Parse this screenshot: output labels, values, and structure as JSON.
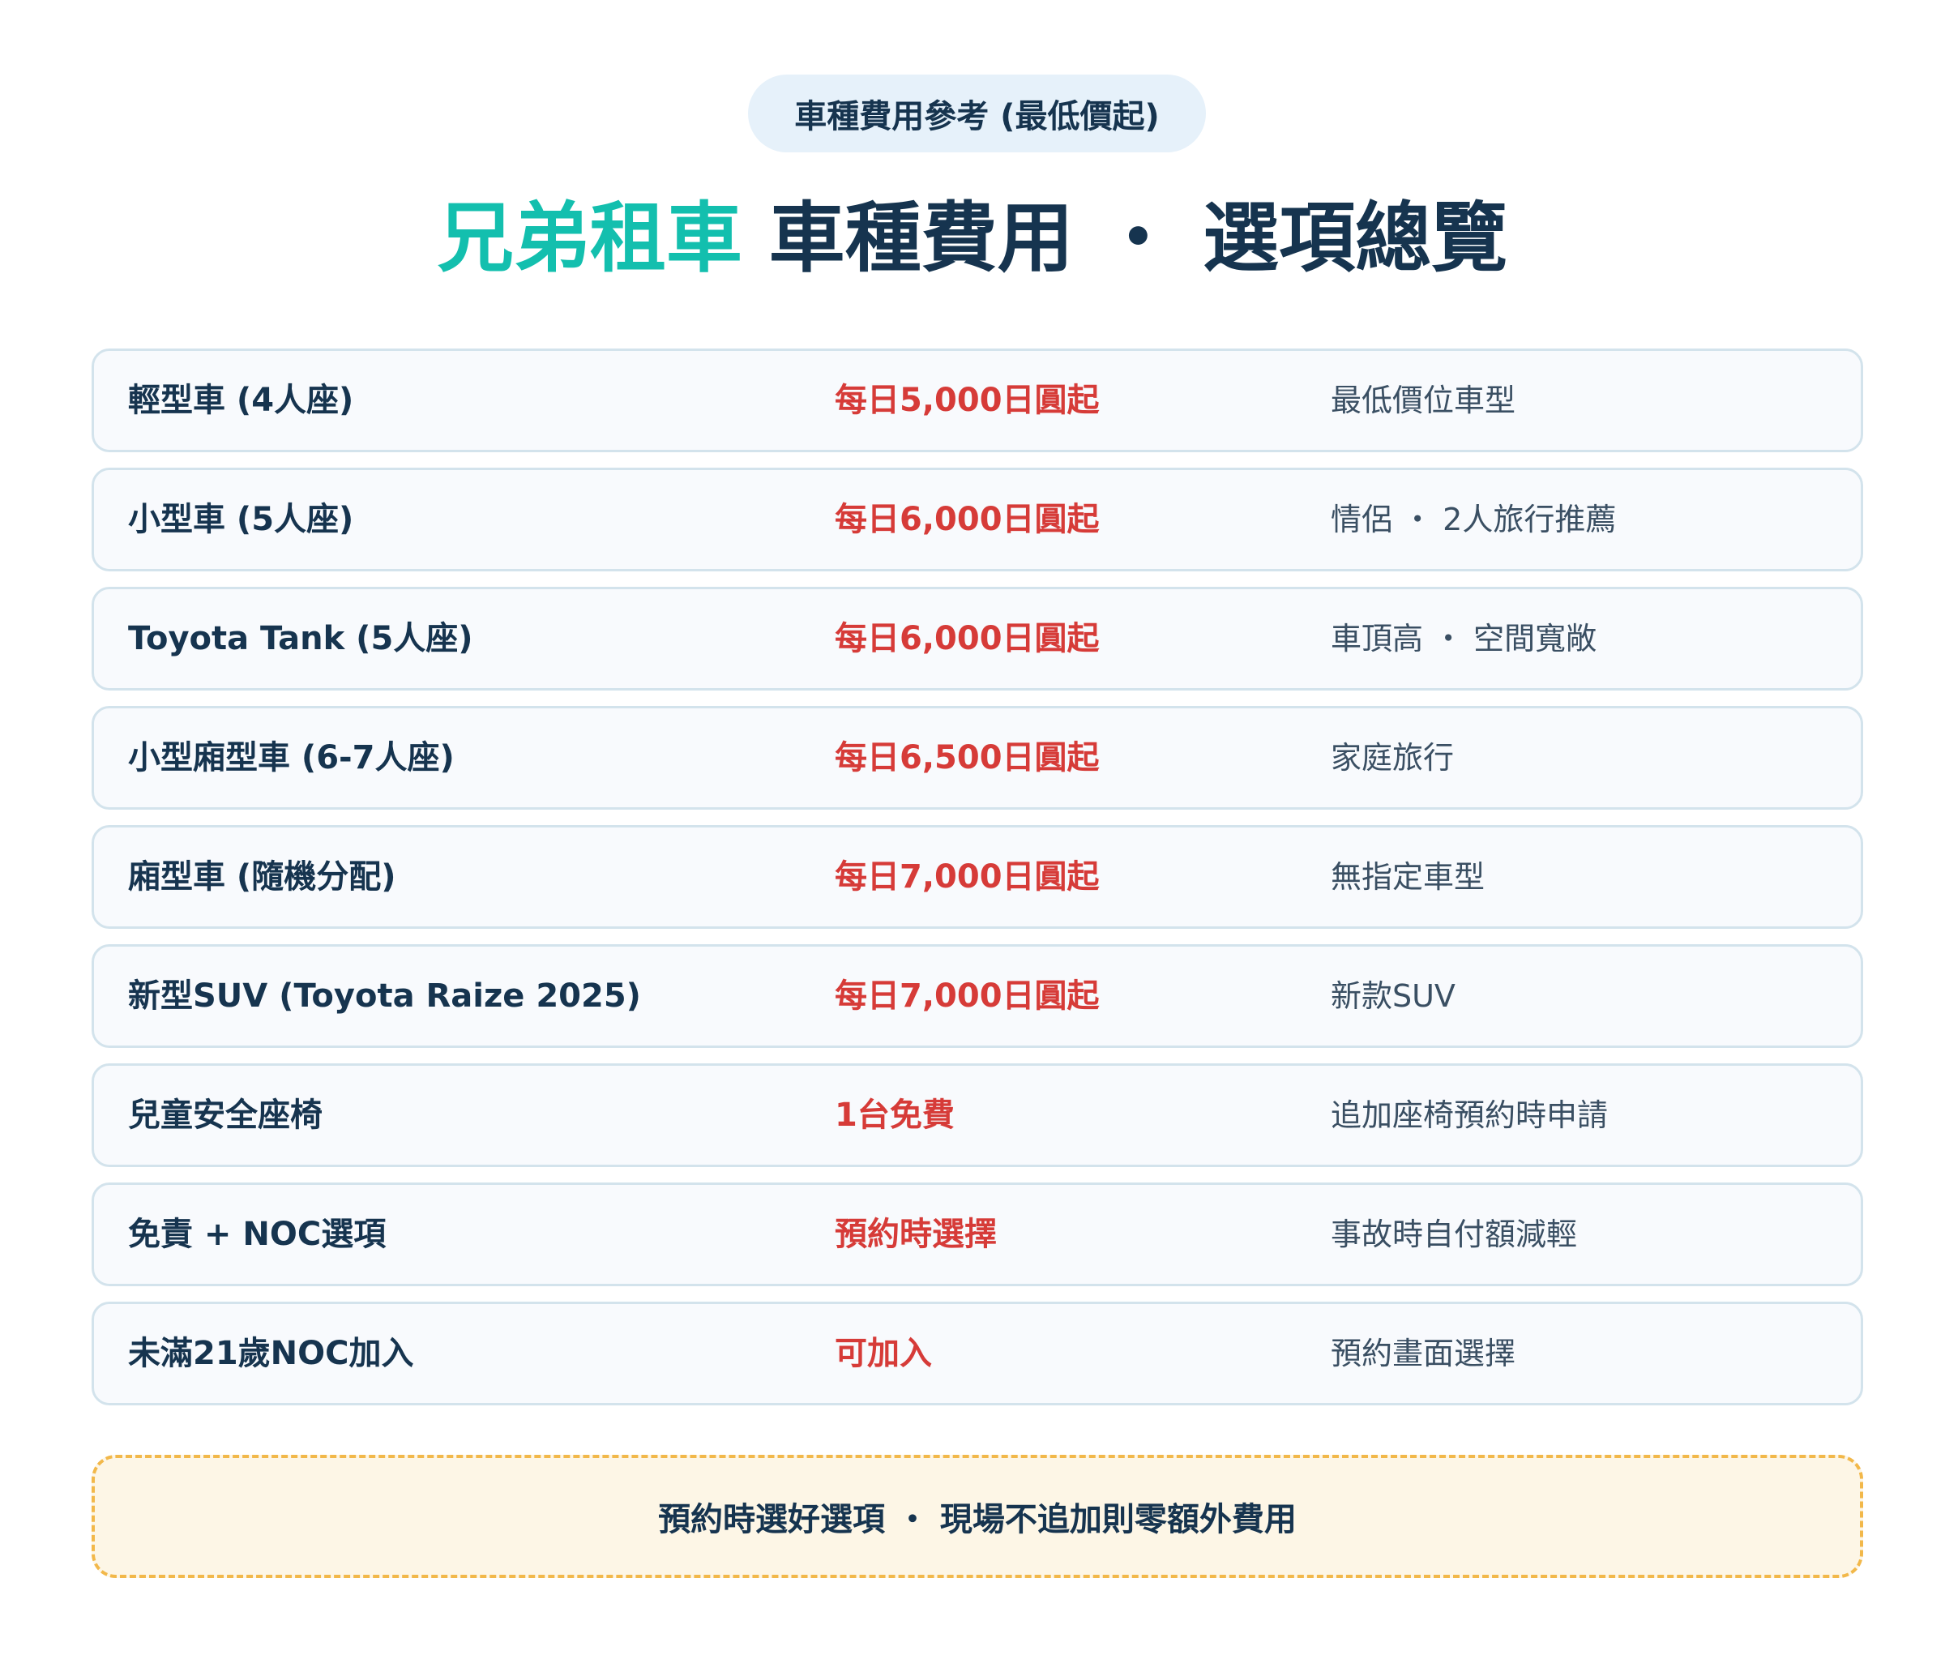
{
  "header": {
    "badge": "車種費用參考 (最低價起)",
    "title_brand": "兄弟租車",
    "title_rest": " 車種費用 ・ 選項總覽"
  },
  "rows": [
    {
      "name": "輕型車 (4人座)",
      "price": "每日5,000日圓起",
      "note": "最低價位車型"
    },
    {
      "name": "小型車 (5人座)",
      "price": "每日6,000日圓起",
      "note": "情侶 ・ 2人旅行推薦"
    },
    {
      "name": "Toyota Tank (5人座)",
      "price": "每日6,000日圓起",
      "note": "車頂高 ・ 空間寬敞"
    },
    {
      "name": "小型廂型車 (6-7人座)",
      "price": "每日6,500日圓起",
      "note": "家庭旅行"
    },
    {
      "name": "廂型車 (隨機分配)",
      "price": "每日7,000日圓起",
      "note": "無指定車型"
    },
    {
      "name": "新型SUV (Toyota Raize 2025)",
      "price": "每日7,000日圓起",
      "note": "新款SUV"
    },
    {
      "name": "兒童安全座椅",
      "price": "1台免費",
      "note": "追加座椅預約時申請"
    },
    {
      "name": "免責 + NOC選項",
      "price": "預約時選擇",
      "note": "事故時自付額減輕"
    },
    {
      "name": "未滿21歲NOC加入",
      "price": "可加入",
      "note": "預約畫面選擇"
    }
  ],
  "footer": {
    "note": "預約時選好選項 ・ 現場不追加則零額外費用"
  },
  "colors": {
    "brand": "#13bfae",
    "navy": "#16344f",
    "price_red": "#d63b38",
    "note_border": "#f2b84a"
  }
}
